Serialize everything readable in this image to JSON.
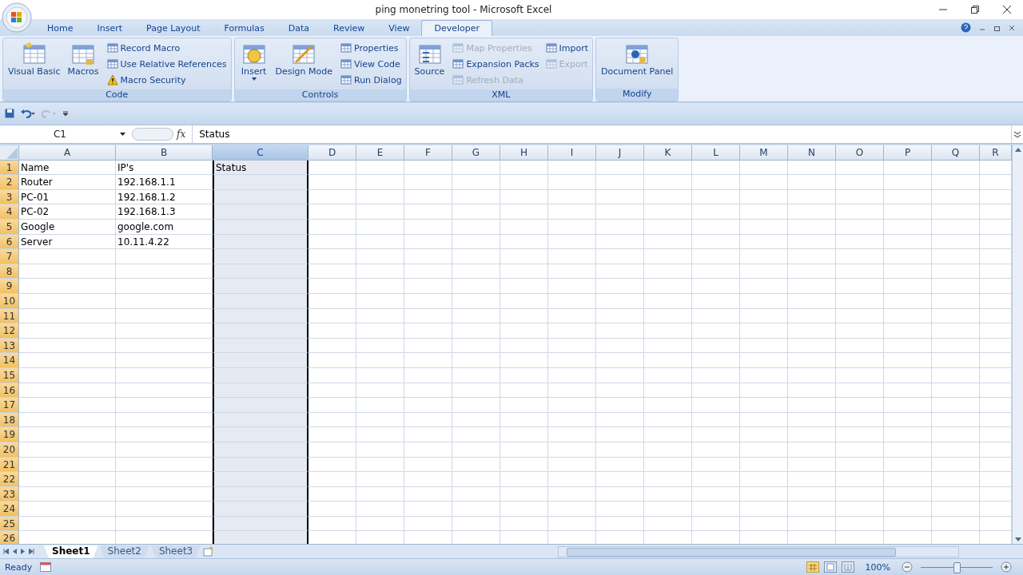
{
  "window": {
    "title": "ping monetring tool - Microsoft Excel"
  },
  "tabs": [
    {
      "label": "Home",
      "selected": false
    },
    {
      "label": "Insert",
      "selected": false
    },
    {
      "label": "Page Layout",
      "selected": false
    },
    {
      "label": "Formulas",
      "selected": false
    },
    {
      "label": "Data",
      "selected": false
    },
    {
      "label": "Review",
      "selected": false
    },
    {
      "label": "View",
      "selected": false
    },
    {
      "label": "Developer",
      "selected": true
    }
  ],
  "ribbon": [
    {
      "label": "Code",
      "items": [
        {
          "kind": "large",
          "label": "Visual Basic",
          "disabled": false
        },
        {
          "kind": "large",
          "label": "Macros",
          "disabled": false
        },
        {
          "kind": "small",
          "label": "Record Macro",
          "disabled": false
        },
        {
          "kind": "small",
          "label": "Use Relative References",
          "disabled": false
        },
        {
          "kind": "small",
          "label": "Macro Security",
          "disabled": false
        }
      ]
    },
    {
      "label": "Controls",
      "items": [
        {
          "kind": "large",
          "label": "Insert",
          "disabled": false
        },
        {
          "kind": "large",
          "label": "Design Mode",
          "disabled": false
        },
        {
          "kind": "small",
          "label": "Properties",
          "disabled": false
        },
        {
          "kind": "small",
          "label": "View Code",
          "disabled": false
        },
        {
          "kind": "small",
          "label": "Run Dialog",
          "disabled": false
        }
      ]
    },
    {
      "label": "XML",
      "items": [
        {
          "kind": "large",
          "label": "Source",
          "disabled": false
        },
        {
          "kind": "small",
          "label": "Map Properties",
          "disabled": true
        },
        {
          "kind": "small",
          "label": "Expansion Packs",
          "disabled": false
        },
        {
          "kind": "small",
          "label": "Refresh Data",
          "disabled": true
        },
        {
          "kind": "small",
          "label": "Import",
          "disabled": false
        },
        {
          "kind": "small",
          "label": "Export",
          "disabled": true
        }
      ]
    },
    {
      "label": "Modify",
      "items": [
        {
          "kind": "large",
          "label": "Document Panel",
          "disabled": false
        }
      ]
    }
  ],
  "formula_bar": {
    "name_box": "C1",
    "function_label": "fx",
    "value": "Status"
  },
  "sheet": {
    "columns": [
      {
        "label": "A",
        "selected": false
      },
      {
        "label": "B",
        "selected": false
      },
      {
        "label": "C",
        "selected": true
      },
      {
        "label": "D",
        "selected": false
      },
      {
        "label": "E",
        "selected": false
      },
      {
        "label": "F",
        "selected": false
      },
      {
        "label": "G",
        "selected": false
      },
      {
        "label": "H",
        "selected": false
      },
      {
        "label": "I",
        "selected": false
      },
      {
        "label": "J",
        "selected": false
      },
      {
        "label": "K",
        "selected": false
      },
      {
        "label": "L",
        "selected": false
      },
      {
        "label": "M",
        "selected": false
      },
      {
        "label": "N",
        "selected": false
      },
      {
        "label": "O",
        "selected": false
      },
      {
        "label": "P",
        "selected": false
      },
      {
        "label": "Q",
        "selected": false
      },
      {
        "label": "R",
        "selected": false
      }
    ],
    "rows": [
      {
        "number": "1",
        "cells": [
          "Name",
          "IP's",
          "Status"
        ]
      },
      {
        "number": "2",
        "cells": [
          "Router",
          "192.168.1.1"
        ]
      },
      {
        "number": "3",
        "cells": [
          "PC-01",
          "192.168.1.2"
        ]
      },
      {
        "number": "4",
        "cells": [
          "PC-02",
          "192.168.1.3"
        ]
      },
      {
        "number": "5",
        "cells": [
          "Google",
          "google.com"
        ]
      },
      {
        "number": "6",
        "cells": [
          "Server",
          "10.11.4.22"
        ]
      },
      {
        "number": "7"
      },
      {
        "number": "8"
      },
      {
        "number": "9"
      },
      {
        "number": "10"
      },
      {
        "number": "11"
      },
      {
        "number": "12"
      },
      {
        "number": "13"
      },
      {
        "number": "14"
      },
      {
        "number": "15"
      },
      {
        "number": "16"
      },
      {
        "number": "17"
      },
      {
        "number": "18"
      },
      {
        "number": "19"
      },
      {
        "number": "20"
      },
      {
        "number": "21"
      },
      {
        "number": "22"
      },
      {
        "number": "23"
      },
      {
        "number": "24"
      },
      {
        "number": "25"
      },
      {
        "number": "26"
      }
    ]
  },
  "sheet_tabs": [
    {
      "label": "Sheet1",
      "selected": true
    },
    {
      "label": "Sheet2",
      "selected": false
    },
    {
      "label": "Sheet3",
      "selected": false
    }
  ],
  "status_bar": {
    "text": "Ready",
    "zoom": {
      "reading": "100%",
      "level": 0.5
    }
  }
}
